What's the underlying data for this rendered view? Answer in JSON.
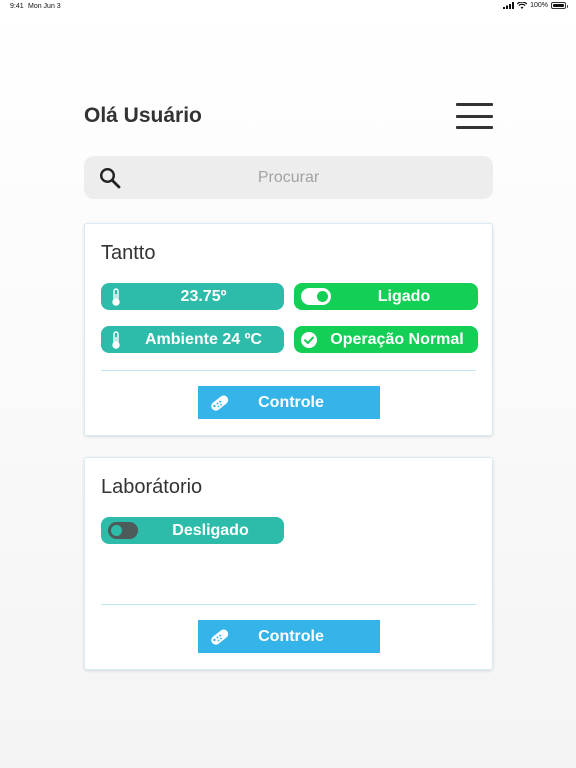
{
  "status_bar": {
    "time": "9:41",
    "date": "Mon Jun 3",
    "battery": "100%"
  },
  "header": {
    "greeting": "Olá Usuário"
  },
  "search": {
    "placeholder": "Procurar"
  },
  "colors": {
    "teal": "#2ebcaa",
    "green": "#14cf55",
    "button_blue": "#34b4e8"
  },
  "devices": [
    {
      "name": "Tantto",
      "temperature": "23.75º",
      "power_status": "Ligado",
      "ambient": "Ambiente 24 ºC",
      "operation": "Operação Normal",
      "control_label": "Controle"
    },
    {
      "name": "Laborátorio",
      "power_status": "Desligado",
      "control_label": "Controle"
    }
  ]
}
